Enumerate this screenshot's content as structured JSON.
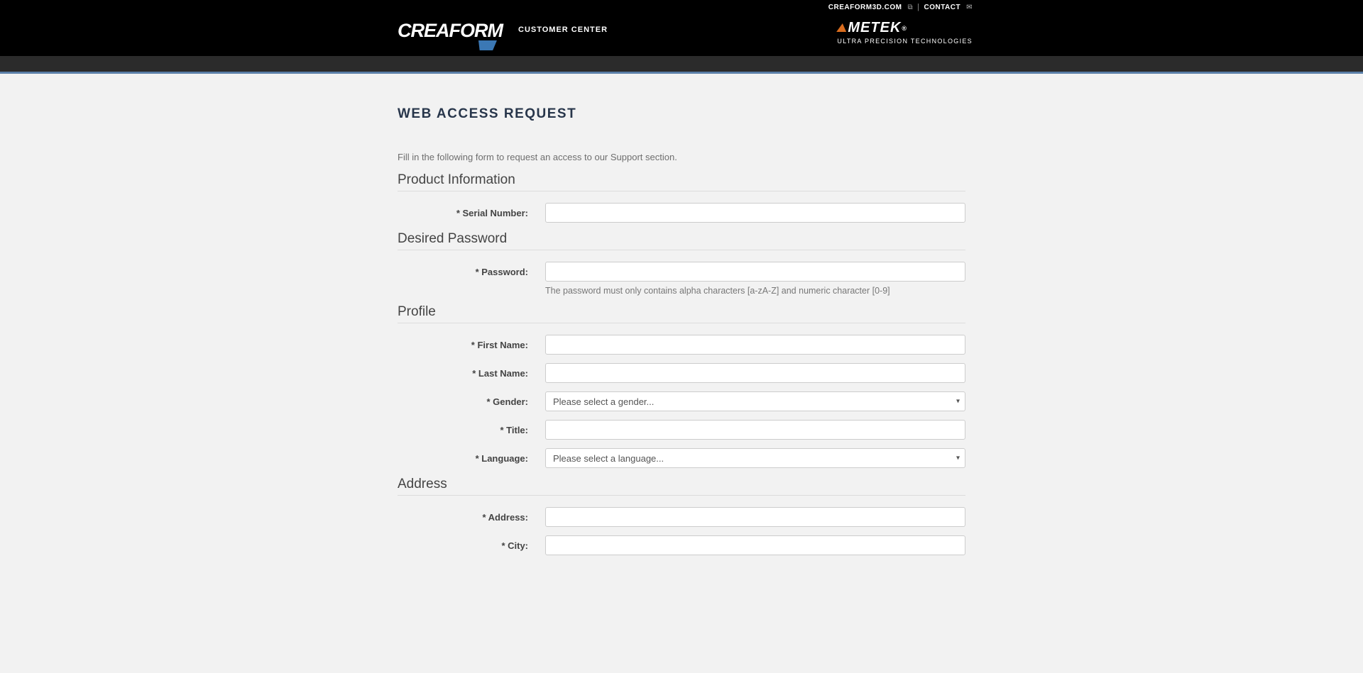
{
  "header": {
    "brand_word": "CREAFORM",
    "customer_center": "CUSTOMER CENTER",
    "link_creaform3d": "CREAFORM3D.COM",
    "link_contact": "CONTACT",
    "ametek": "METEK",
    "ametek_sub": "ULTRA PRECISION TECHNOLOGIES"
  },
  "page": {
    "title": "WEB ACCESS REQUEST",
    "intro": "Fill in the following form to request an access to our Support section."
  },
  "sections": {
    "product_info": "Product Information",
    "desired_password": "Desired Password",
    "profile": "Profile",
    "address": "Address"
  },
  "labels": {
    "serial_number": "* Serial Number:",
    "password": "* Password:",
    "password_hint": "The password must only contains alpha characters [a-zA-Z] and numeric character [0-9]",
    "first_name": "* First Name:",
    "last_name": "* Last Name:",
    "gender": "* Gender:",
    "title": "* Title:",
    "language": "* Language:",
    "address": "* Address:",
    "city": "* City:"
  },
  "selects": {
    "gender_placeholder": "Please select a gender...",
    "language_placeholder": "Please select a language..."
  }
}
